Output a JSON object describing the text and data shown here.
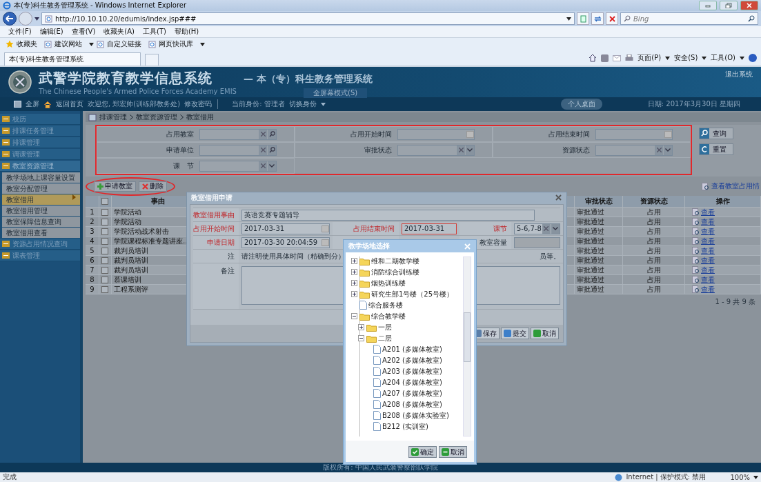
{
  "browser": {
    "title": "本(专)科生教务管理系统 - Windows Internet Explorer",
    "url": "http://10.10.10.20/edumis/index.jsp###",
    "search_placeholder": "Bing",
    "menu": [
      "文件(F)",
      "编辑(E)",
      "查看(V)",
      "收藏夹(A)",
      "工具(T)",
      "帮助(H)"
    ],
    "favorites": [
      {
        "label": "收藏夹",
        "kind": "star"
      },
      {
        "label": "建议网站",
        "kind": "page-menu"
      },
      {
        "label": "自定义链接",
        "kind": "page"
      },
      {
        "label": "网页快讯库",
        "kind": "page-menu"
      }
    ],
    "tab": "本(专)科生教务管理系统",
    "commands": [
      "页面(P)",
      "安全(S)",
      "工具(O)"
    ]
  },
  "header": {
    "title": "武警学院教育教学信息系统",
    "subtitle": "The Chinese People's Armed Police Forces Academy EMIS",
    "system": "— 本（专）科生教务管理系统",
    "tooltip": "全屏幕模式(S)",
    "logout": "退出系统"
  },
  "nav": {
    "fullscreen": "全屏",
    "home": "返回首页",
    "welcome": "欢迎您, 郑宏帅(训练部教务处)",
    "change_password": "修改密码",
    "identity": "当前身份: 管理者",
    "switch": "切换身份",
    "desktop": "个人桌面",
    "date": "日期: 2017年3月30日 星期四"
  },
  "sidebar": {
    "items": [
      {
        "label": "校历",
        "expanded": false
      },
      {
        "label": "排课任务管理",
        "expanded": false
      },
      {
        "label": "排课管理",
        "expanded": false
      },
      {
        "label": "调课管理",
        "expanded": false
      },
      {
        "label": "教室资源管理",
        "expanded": true,
        "children": [
          {
            "label": "教学场地上课容量设置",
            "selected": false
          },
          {
            "label": "教室分配管理",
            "selected": false
          },
          {
            "label": "教室借用",
            "selected": true
          },
          {
            "label": "教室借用管理",
            "selected": false
          },
          {
            "label": "教室保障信息查询",
            "selected": false
          },
          {
            "label": "教室借用查看",
            "selected": false
          }
        ]
      },
      {
        "label": "资源占用情况查询",
        "expanded": false
      },
      {
        "label": "课表管理",
        "expanded": false
      }
    ]
  },
  "breadcrumb": [
    "排课管理",
    "教室资源管理",
    "教室借用"
  ],
  "search": {
    "fields": [
      {
        "label": "占用教室",
        "kind": "lookup"
      },
      {
        "label": "占用开始时间",
        "kind": "date"
      },
      {
        "label": "占用结束时间",
        "kind": "date"
      },
      {
        "label": "申请单位",
        "kind": "lookup"
      },
      {
        "label": "审批状态",
        "kind": "select"
      },
      {
        "label": "资源状态",
        "kind": "select"
      },
      {
        "label": "课　节",
        "kind": "select"
      }
    ],
    "buttons": [
      {
        "label": "查询",
        "kind": "search"
      },
      {
        "label": "重置",
        "kind": "reset"
      }
    ]
  },
  "toolbar": [
    {
      "label": "申请教室",
      "kind": "add"
    },
    {
      "label": "删除",
      "kind": "delete"
    }
  ],
  "view_link": "查看教室占用情",
  "table": {
    "all_checked": false,
    "columns": [
      "事由",
      "审批状态",
      "资源状态",
      "操作"
    ],
    "rows": [
      {
        "index": "1",
        "checked": false,
        "reason": "学院活动",
        "approval": "审批通过",
        "resource": "占用",
        "action": "查看"
      },
      {
        "index": "2",
        "checked": false,
        "reason": "学院活动",
        "approval": "审批通过",
        "resource": "占用",
        "action": "查看"
      },
      {
        "index": "3",
        "checked": false,
        "reason": "学院活动战术射击",
        "approval": "审批通过",
        "resource": "占用",
        "action": "查看"
      },
      {
        "index": "4",
        "checked": false,
        "reason": "学院课程标准专题讲座…",
        "approval": "审批通过",
        "resource": "占用",
        "action": "查看"
      },
      {
        "index": "5",
        "checked": false,
        "reason": "裁判员培训",
        "approval": "审批通过",
        "resource": "占用",
        "action": "查看"
      },
      {
        "index": "6",
        "checked": false,
        "reason": "裁判员培训",
        "approval": "审批通过",
        "resource": "占用",
        "action": "查看"
      },
      {
        "index": "7",
        "checked": false,
        "reason": "裁判员培训",
        "approval": "审批通过",
        "resource": "占用",
        "action": "查看"
      },
      {
        "index": "8",
        "checked": false,
        "reason": "慕课培训",
        "approval": "审批通过",
        "resource": "占用",
        "action": "查看"
      },
      {
        "index": "9",
        "checked": false,
        "reason": "工程系测评",
        "approval": "审批通过",
        "resource": "占用",
        "action": "查看"
      }
    ],
    "pager": "1 - 9 共 9 条"
  },
  "dialog": {
    "title": "教室借用申请",
    "reason": {
      "label": "教室借用事由",
      "value": "英语竞赛专题辅导",
      "required": true
    },
    "row2": [
      {
        "label": "占用开始时间",
        "value": "2017-03-31",
        "kind": "date",
        "required": true,
        "invalid": false
      },
      {
        "label": "占用结束时间",
        "value": "2017-03-31",
        "kind": "text",
        "required": true,
        "invalid": true
      },
      {
        "label": "课节",
        "value": "5-6,7-8",
        "kind": "select",
        "required": true,
        "invalid": false
      }
    ],
    "apply_date": {
      "label": "申请日期",
      "value": "2017-03-30 20:04:59",
      "required": true
    },
    "capacity": {
      "label": "教室容量",
      "required": false
    },
    "note": {
      "label": "注",
      "text": "请注明使用具体时间（精确到分）",
      "tail": "员等。"
    },
    "remark": {
      "label": "备注"
    },
    "buttons": [
      {
        "label": "保存",
        "kind": "save"
      },
      {
        "label": "提交",
        "kind": "submit"
      },
      {
        "label": "取消",
        "kind": "cancel"
      }
    ]
  },
  "picker": {
    "title": "教学场地选择",
    "tree": [
      {
        "label": "维和二期教学楼",
        "kind": "folder",
        "expanded": false
      },
      {
        "label": "消防综合训练楼",
        "kind": "folder",
        "expanded": false
      },
      {
        "label": "烟热训练楼",
        "kind": "folder",
        "expanded": false
      },
      {
        "label": "研究生部1号楼（25号楼）",
        "kind": "folder",
        "expanded": false
      },
      {
        "label": "综合服务楼",
        "kind": "room"
      },
      {
        "label": "综合教学楼",
        "kind": "folder",
        "expanded": true,
        "children": [
          {
            "label": "一层",
            "kind": "folder",
            "expanded": false
          },
          {
            "label": "二层",
            "kind": "folder",
            "expanded": true,
            "children": [
              {
                "label": "A201 (多媒体教室)",
                "kind": "room"
              },
              {
                "label": "A202 (多媒体教室)",
                "kind": "room"
              },
              {
                "label": "A203 (多媒体教室)",
                "kind": "room"
              },
              {
                "label": "A204 (多媒体教室)",
                "kind": "room"
              },
              {
                "label": "A207 (多媒体教室)",
                "kind": "room"
              },
              {
                "label": "A208 (多媒体教室)",
                "kind": "room"
              },
              {
                "label": "B208 (多媒体实验室)",
                "kind": "room"
              },
              {
                "label": "B212 (实训室)",
                "kind": "room"
              }
            ]
          }
        ]
      }
    ],
    "buttons": [
      {
        "label": "确定",
        "kind": "ok"
      },
      {
        "label": "取消",
        "kind": "cancel"
      }
    ]
  },
  "footer": "版权所有: 中国人民武装警察部队学院",
  "status_bar": {
    "left": "完成",
    "zone": "Internet | 保护模式: 禁用",
    "zoom": "100%"
  }
}
